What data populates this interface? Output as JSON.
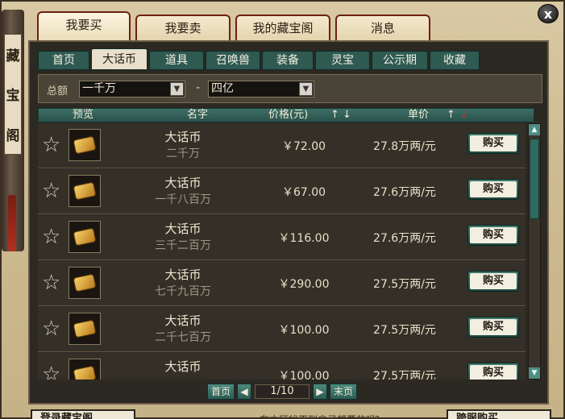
{
  "window": {
    "scroll_title": [
      "藏",
      "宝",
      "阁"
    ],
    "close_label": "x"
  },
  "top_tabs": [
    {
      "label": "我要买",
      "active": true
    },
    {
      "label": "我要卖",
      "active": false
    },
    {
      "label": "我的藏宝阁",
      "active": false
    },
    {
      "label": "消息",
      "active": false
    }
  ],
  "sub_tabs": [
    {
      "label": "首页",
      "active": false
    },
    {
      "label": "大话币",
      "active": true
    },
    {
      "label": "道具",
      "active": false
    },
    {
      "label": "召唤兽",
      "active": false
    },
    {
      "label": "装备",
      "active": false
    },
    {
      "label": "灵宝",
      "active": false
    },
    {
      "label": "公示期",
      "active": false
    },
    {
      "label": "收藏",
      "active": false
    }
  ],
  "filter": {
    "label": "总额",
    "min_value": "一千万",
    "separator": "-",
    "max_value": "四亿"
  },
  "columns": {
    "preview": "预览",
    "name": "名字",
    "price": "价格(元)",
    "price_sort": "↑ ↓",
    "unit_price": "单价",
    "unit_sort_up": "↑",
    "unit_sort_down": "↓"
  },
  "listings": [
    {
      "name": "大话币",
      "amount": "二千万",
      "price": "￥72.00",
      "unit_price": "27.8万两/元",
      "buy_label": "购买"
    },
    {
      "name": "大话币",
      "amount": "一千八百万",
      "price": "￥67.00",
      "unit_price": "27.6万两/元",
      "buy_label": "购买"
    },
    {
      "name": "大话币",
      "amount": "三千二百万",
      "price": "￥116.00",
      "unit_price": "27.6万两/元",
      "buy_label": "购买"
    },
    {
      "name": "大话币",
      "amount": "七千九百万",
      "price": "￥290.00",
      "unit_price": "27.5万两/元",
      "buy_label": "购买"
    },
    {
      "name": "大话币",
      "amount": "二千七百万",
      "price": "￥100.00",
      "unit_price": "27.5万两/元",
      "buy_label": "购买"
    },
    {
      "name": "大话币",
      "amount": "",
      "price": "￥100.00",
      "unit_price": "27.5万两/元",
      "buy_label": "购买"
    }
  ],
  "pager": {
    "first_label": "首页",
    "prev_icon": "prev-icon",
    "page_display": "1/10",
    "next_icon": "next-icon",
    "last_label": "末页"
  },
  "footer": {
    "left_button": "登录藏宝阁",
    "note": "在本区找不到自己想要的吗?",
    "right_button": "跨服购买"
  }
}
